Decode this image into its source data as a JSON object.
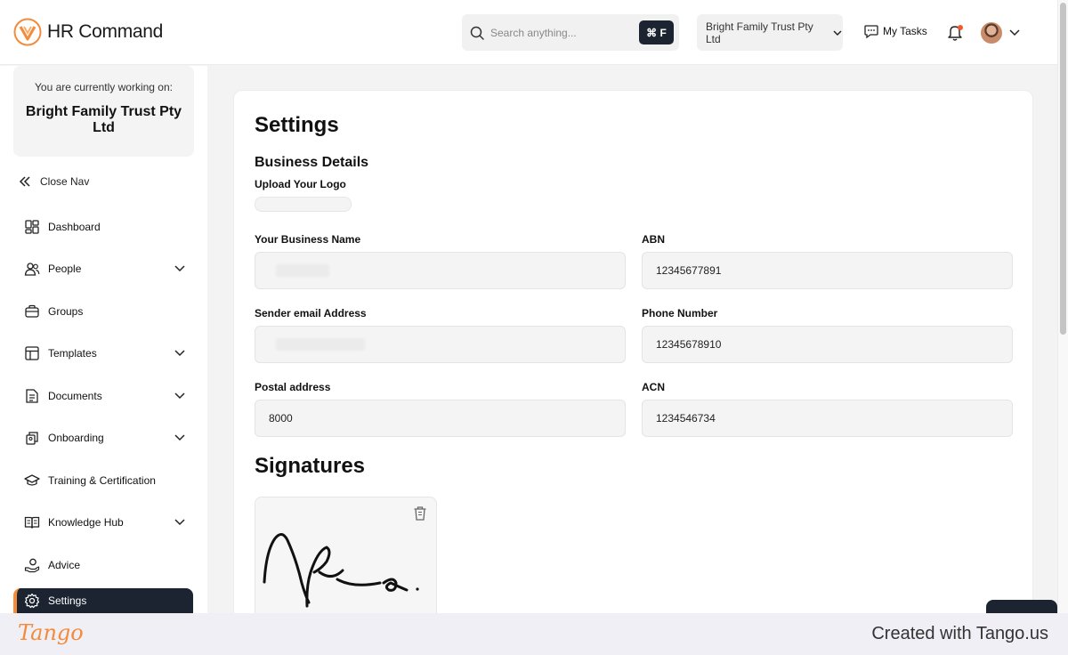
{
  "header": {
    "app_name": "HR Command",
    "search_placeholder": "Search anything...",
    "search_shortcut": "⌘ F",
    "company": "Bright Family Trust Pty Ltd",
    "tasks_label": "My Tasks"
  },
  "sidebar": {
    "workspace_caption": "You are currently working on:",
    "workspace_name": "Bright Family Trust Pty Ltd",
    "close_nav": "Close Nav",
    "items": [
      {
        "label": "Dashboard",
        "icon": "dashboard-icon",
        "has_children": false
      },
      {
        "label": "People",
        "icon": "people-icon",
        "has_children": true
      },
      {
        "label": "Groups",
        "icon": "briefcase-icon",
        "has_children": false
      },
      {
        "label": "Templates",
        "icon": "template-icon",
        "has_children": true
      },
      {
        "label": "Documents",
        "icon": "document-icon",
        "has_children": true
      },
      {
        "label": "Onboarding",
        "icon": "onboarding-icon",
        "has_children": true
      },
      {
        "label": "Training & Certification",
        "icon": "graduation-cap-icon",
        "has_children": false
      },
      {
        "label": "Knowledge Hub",
        "icon": "book-icon",
        "has_children": true
      },
      {
        "label": "Advice",
        "icon": "hand-coin-icon",
        "has_children": false
      },
      {
        "label": "Settings",
        "icon": "gear-icon",
        "has_children": false,
        "active": true
      }
    ]
  },
  "main": {
    "title": "Settings",
    "business_details": "Business Details",
    "upload_logo_label": "Upload Your Logo",
    "fields": {
      "business_name": {
        "label": "Your Business Name",
        "value": ""
      },
      "abn": {
        "label": "ABN",
        "value": "12345677891"
      },
      "sender_email": {
        "label": "Sender email Address",
        "value": ""
      },
      "phone": {
        "label": "Phone Number",
        "value": "12345678910"
      },
      "postal": {
        "label": "Postal address",
        "value": "8000"
      },
      "acn": {
        "label": "ACN",
        "value": "1234546734"
      }
    },
    "signatures_title": "Signatures"
  },
  "footer": {
    "logo": "Tango",
    "credit": "Created with Tango.us"
  },
  "colors": {
    "accent": "#f28b3a",
    "nav_active_bg": "#1b2430",
    "field_bg": "#f4f4f4"
  }
}
